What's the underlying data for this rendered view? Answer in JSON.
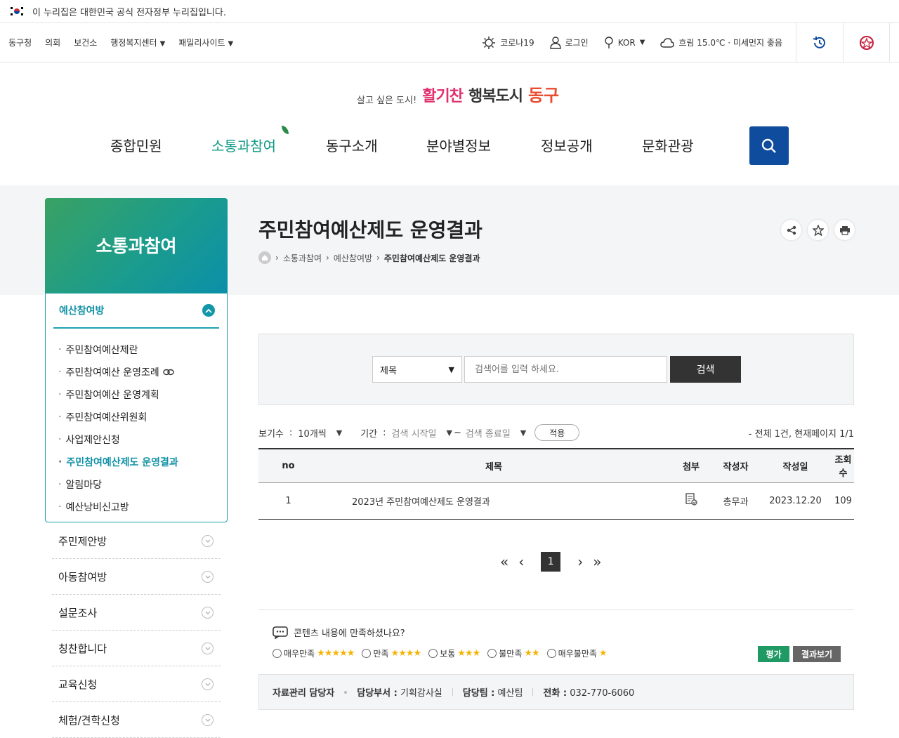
{
  "gov_banner": {
    "text": "이 누리집은 대한민국 공식 전자정부 누리집입니다."
  },
  "util_nav": {
    "left": [
      "동구청",
      "의회",
      "보건소",
      "행정복지센터",
      "패밀리사이트"
    ],
    "corona": "코로나19",
    "login": "로그인",
    "lang": "KOR",
    "weather": "흐림 15.0℃ · 미세먼지 좋음"
  },
  "logo": {
    "slogan_small": "살고 싶은 도시!",
    "slogan_mid1": "활기찬",
    "slogan_mid2": "행복도시",
    "name": "동구"
  },
  "gnb": [
    "종합민원",
    "소통과참여",
    "동구소개",
    "분야별정보",
    "정보공개",
    "문화관광"
  ],
  "lnb": {
    "title": "소통과참여",
    "section": "예산참여방",
    "items": [
      "주민참여예산제란",
      "주민참여예산 운영조례",
      "주민참여예산 운영계획",
      "주민참여예산위원회",
      "사업제안신청",
      "주민참여예산제도 운영결과",
      "알림마당",
      "예산낭비신고방"
    ],
    "others": [
      "주민제안방",
      "아동참여방",
      "설문조사",
      "칭찬합니다",
      "교육신청",
      "체험/견학신청"
    ]
  },
  "page": {
    "title": "주민참여예산제도 운영결과",
    "breadcrumb": [
      "소통과참여",
      "예산참여방",
      "주민참여예산제도 운영결과"
    ]
  },
  "search": {
    "select_value": "제목",
    "placeholder": "검색어를 입력 하세요.",
    "button": "검색"
  },
  "filters": {
    "rows_label": "보기수",
    "rows_value": "10개씩",
    "period_label": "기간",
    "start_ph": "검색 시작일",
    "tilde": "~",
    "end_ph": "검색 종료일",
    "apply": "적용",
    "total": "- 전체 1건, 현재페이지 1/1"
  },
  "table": {
    "headers": [
      "no",
      "제목",
      "첨부",
      "작성자",
      "작성일",
      "조회수"
    ],
    "rows": [
      {
        "no": "1",
        "title": "2023년 주민참여예산제도 운영결과",
        "writer": "총무과",
        "date": "2023.12.20",
        "views": "109"
      }
    ]
  },
  "pagination": {
    "current": "1"
  },
  "survey": {
    "question": "콘텐츠 내용에 만족하셨나요?",
    "options": [
      {
        "label": "매우만족",
        "stars": "★★★★★"
      },
      {
        "label": "만족",
        "stars": "★★★★"
      },
      {
        "label": "보통",
        "stars": "★★★"
      },
      {
        "label": "불만족",
        "stars": "★★"
      },
      {
        "label": "매우불만족",
        "stars": "★"
      }
    ],
    "evaluate": "평가",
    "result": "결과보기"
  },
  "manager": {
    "label": "자료관리 담당자",
    "dept_label": "담당부서 :",
    "dept": "기획감사실",
    "team_label": "담당팀 :",
    "team": "예산팀",
    "tel_label": "전화 :",
    "tel": "032-770-6060"
  },
  "colors": {
    "accent": "#0f9a86",
    "search_blue": "#0f4c9e",
    "lnb_teal": "#1191a6"
  }
}
